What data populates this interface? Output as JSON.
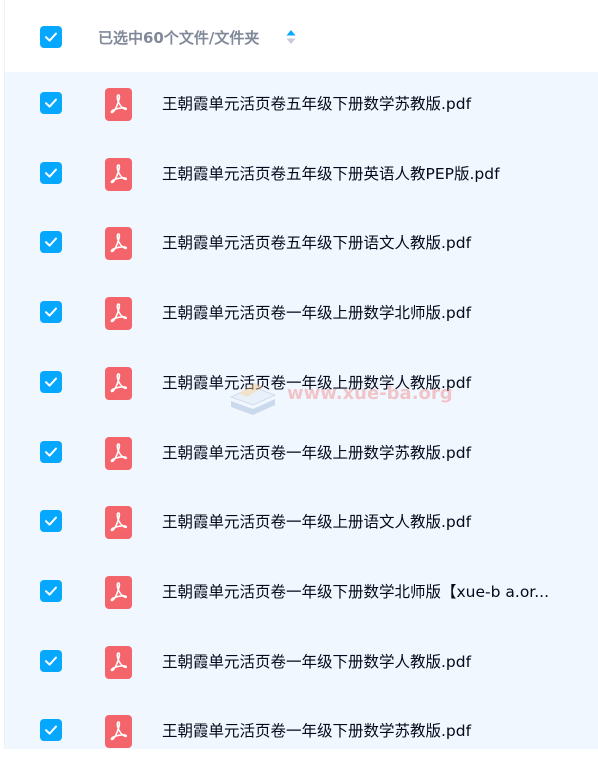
{
  "header": {
    "select_all_checked": true,
    "selection_text": "已选中60个文件/文件夹",
    "sort_icon": "sort-arrows-icon"
  },
  "colors": {
    "accent": "#06a7ff",
    "list_background": "#f1f7ff",
    "pdf_red": "#f4646b",
    "header_text": "#818999",
    "filename_text": "#03081a"
  },
  "files": [
    {
      "name": "王朝霞单元活页卷五年级下册数学苏教版.pdf",
      "checked": true,
      "icon": "pdf-icon"
    },
    {
      "name": "王朝霞单元活页卷五年级下册英语人教PEP版.pdf",
      "checked": true,
      "icon": "pdf-icon"
    },
    {
      "name": "王朝霞单元活页卷五年级下册语文人教版.pdf",
      "checked": true,
      "icon": "pdf-icon"
    },
    {
      "name": "王朝霞单元活页卷一年级上册数学北师版.pdf",
      "checked": true,
      "icon": "pdf-icon"
    },
    {
      "name": "王朝霞单元活页卷一年级上册数学人教版.pdf",
      "checked": true,
      "icon": "pdf-icon"
    },
    {
      "name": "王朝霞单元活页卷一年级上册数学苏教版.pdf",
      "checked": true,
      "icon": "pdf-icon"
    },
    {
      "name": "王朝霞单元活页卷一年级上册语文人教版.pdf",
      "checked": true,
      "icon": "pdf-icon"
    },
    {
      "name": "王朝霞单元活页卷一年级下册数学北师版【xue-b a.or...",
      "checked": true,
      "icon": "pdf-icon"
    },
    {
      "name": "王朝霞单元活页卷一年级下册数学人教版.pdf",
      "checked": true,
      "icon": "pdf-icon"
    },
    {
      "name": "王朝霞单元活页卷一年级下册数学苏教版.pdf",
      "checked": true,
      "icon": "pdf-icon"
    }
  ],
  "watermark": {
    "text": "www.xue-ba.org"
  }
}
